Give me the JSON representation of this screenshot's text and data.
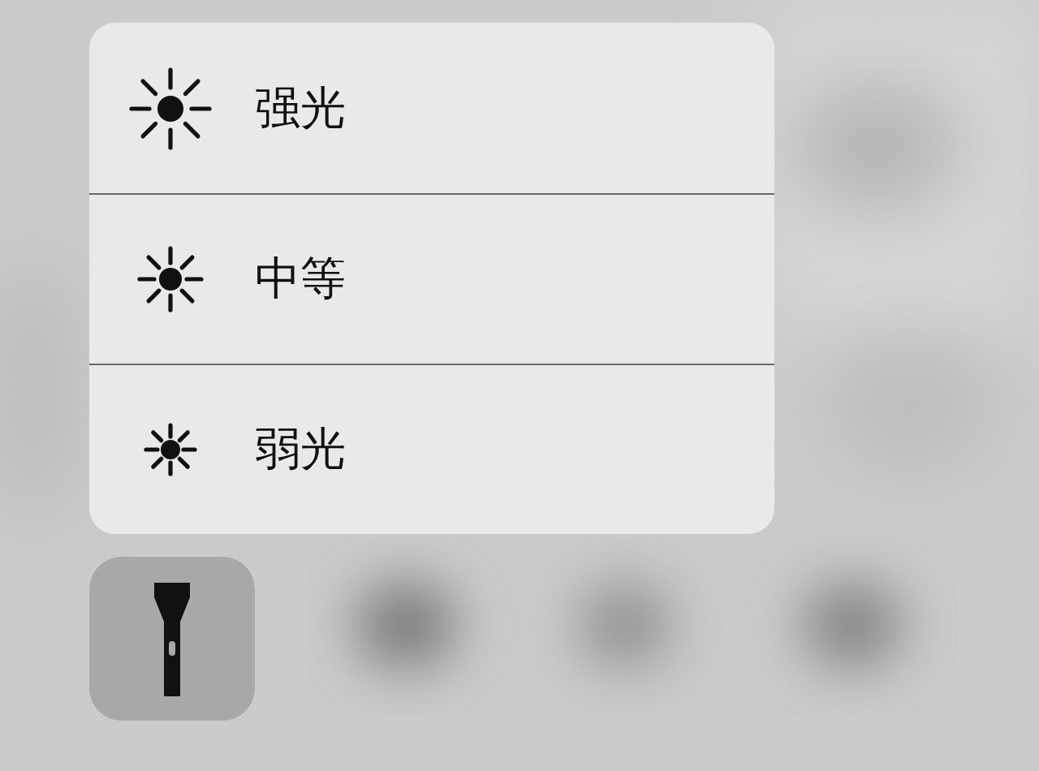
{
  "menu": {
    "items": [
      {
        "label": "强光",
        "kind": "high"
      },
      {
        "label": "中等",
        "kind": "medium"
      },
      {
        "label": "弱光",
        "kind": "low"
      }
    ]
  }
}
